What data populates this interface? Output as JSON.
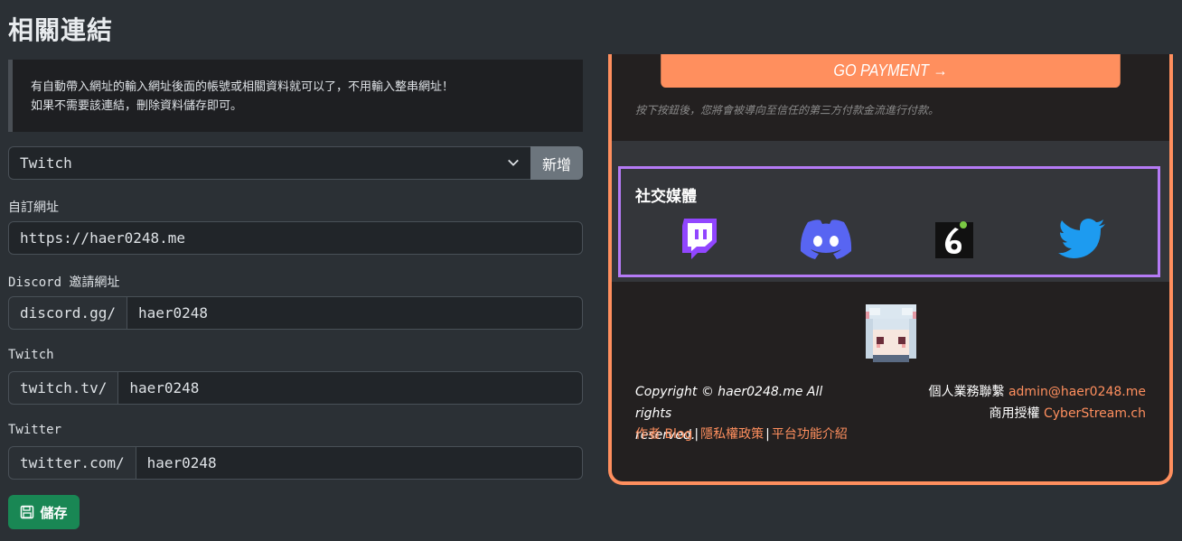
{
  "page_title": "相關連結",
  "note": {
    "line1": "有自動帶入網址的輸入網址後面的帳號或相關資料就可以了，不用輸入整串網址！",
    "line2": "如果不需要該連結，刪除資料儲存即可。"
  },
  "platform_select": {
    "value": "Twitch",
    "add_label": "新增"
  },
  "custom_url": {
    "label": "自訂網址",
    "value": "https://haer0248.me"
  },
  "discord": {
    "label": "Discord 邀請網址",
    "prefix": "discord.gg/",
    "value": "haer0248"
  },
  "twitch": {
    "label": "Twitch",
    "prefix": "twitch.tv/",
    "value": "haer0248"
  },
  "twitter": {
    "label": "Twitter",
    "prefix": "twitter.com/",
    "value": "haer0248"
  },
  "save_label": "儲存",
  "preview": {
    "pay_button": "GO PAYMENT →",
    "pay_note": "按下按鈕後，您將會被導向至信任的第三方付款金流進行付款。",
    "social_title": "社交媒體",
    "social_icons": [
      "twitch-icon",
      "discord-icon",
      "streamlabs-icon",
      "twitter-icon"
    ],
    "copyright_line1": "Copyright © haer0248.me All rights",
    "copyright_line2": "reserved.",
    "links": [
      "作者 Blog",
      "隱私權政策",
      "平台功能介紹"
    ],
    "link_sep": "|",
    "contact_label": "個人業務聯繫",
    "contact_email": "admin@haer0248.me",
    "license_label": "商用授權",
    "license_link": "CyberStream.ch"
  },
  "colors": {
    "accent": "#ff8f5e",
    "social_border": "#b57af5",
    "save": "#198754"
  }
}
